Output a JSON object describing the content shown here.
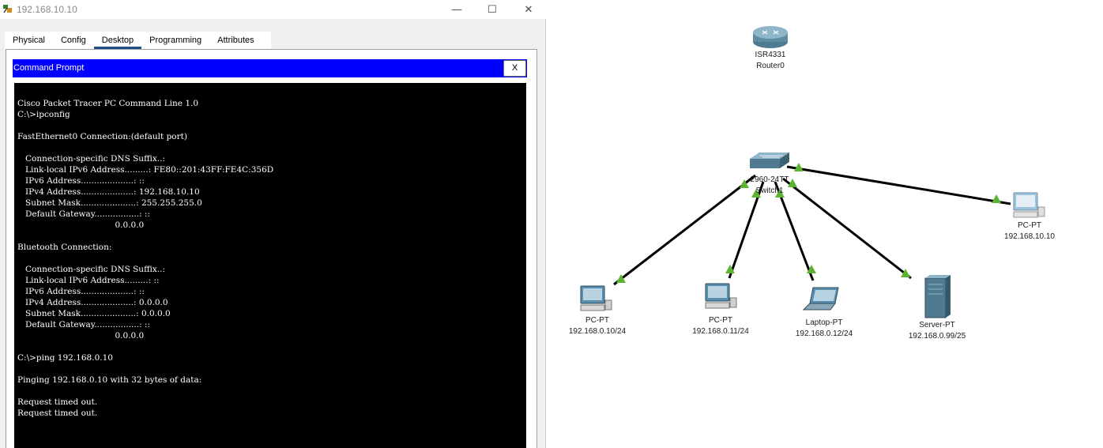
{
  "window": {
    "title": "192.168.10.10",
    "controls": {
      "minimize": "—",
      "maximize": "☐",
      "close": "✕"
    }
  },
  "tabs": [
    {
      "label": "Physical"
    },
    {
      "label": "Config"
    },
    {
      "label": "Desktop",
      "active": true
    },
    {
      "label": "Programming"
    },
    {
      "label": "Attributes"
    }
  ],
  "command_prompt": {
    "title": "Command Prompt",
    "close_label": "X",
    "output": "Cisco Packet Tracer PC Command Line 1.0\nC:\\>ipconfig\n\nFastEthernet0 Connection:(default port)\n\n   Connection-specific DNS Suffix..:\n   Link-local IPv6 Address.........: FE80::201:43FF:FE4C:356D\n   IPv6 Address....................: ::\n   IPv4 Address....................: 192.168.10.10\n   Subnet Mask.....................: 255.255.255.0\n   Default Gateway.................: ::\n                                     0.0.0.0\n\nBluetooth Connection:\n\n   Connection-specific DNS Suffix..:\n   Link-local IPv6 Address.........: ::\n   IPv6 Address....................: ::\n   IPv4 Address....................: 0.0.0.0\n   Subnet Mask.....................: 0.0.0.0\n   Default Gateway.................: ::\n                                     0.0.0.0\n\nC:\\>ping 192.168.0.10\n\nPinging 192.168.0.10 with 32 bytes of data:\n\nRequest timed out.\nRequest timed out."
  },
  "topology": {
    "router": {
      "model": "ISR4331",
      "name": "Router0"
    },
    "switch": {
      "model": "2960-24TT",
      "name": "Switch1"
    },
    "devices": [
      {
        "type": "PC-PT",
        "ip": "192.168.0.10/24",
        "icon": "pc-icon"
      },
      {
        "type": "PC-PT",
        "ip": "192.168.0.11/24",
        "icon": "pc-icon"
      },
      {
        "type": "Laptop-PT",
        "ip": "192.168.0.12/24",
        "icon": "laptop-icon"
      },
      {
        "type": "Server-PT",
        "ip": "192.168.0.99/25",
        "icon": "server-icon"
      },
      {
        "type": "PC-PT",
        "ip": "192.168.10.10",
        "icon": "pc-icon"
      }
    ],
    "link_status_color": "#5cb531"
  }
}
